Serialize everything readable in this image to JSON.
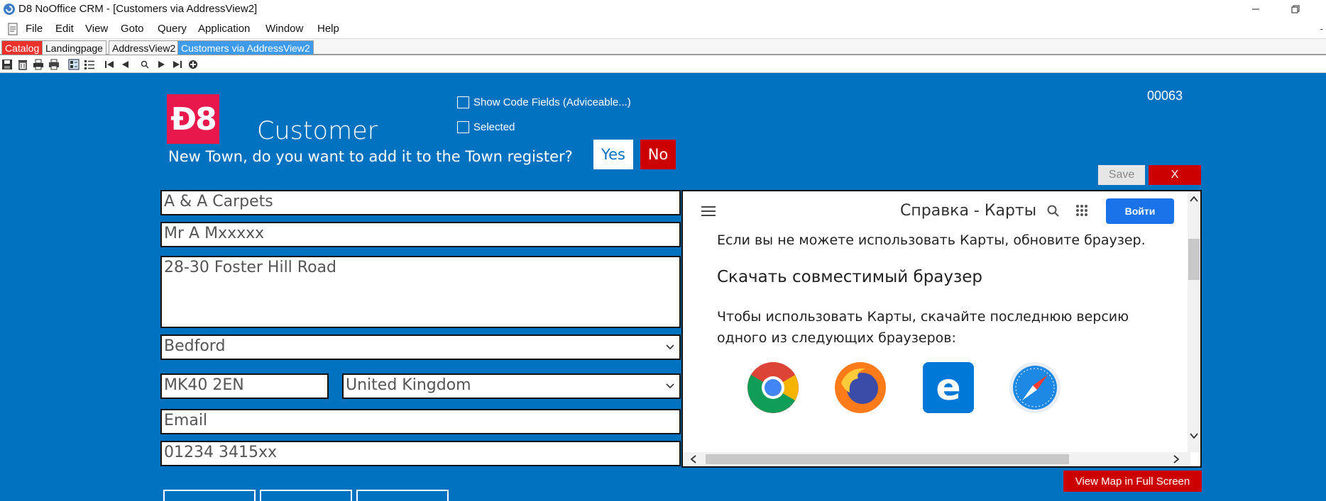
{
  "window": {
    "title": "D8 NoOffice CRM - [Customers via AddressView2]"
  },
  "menu": {
    "items": [
      "File",
      "Edit",
      "View",
      "Goto",
      "Query",
      "Application",
      "Window",
      "Help"
    ],
    "mini": "-"
  },
  "tabs": [
    {
      "label": "Catalog",
      "style": "catalog"
    },
    {
      "label": "Landingpage",
      "style": "plain"
    },
    {
      "label": "AddressView2",
      "style": "plain"
    },
    {
      "label": "Customers via AddressView2",
      "style": "active"
    }
  ],
  "toolbar": {
    "icons": [
      "save-icon",
      "delete-icon",
      "print-preview-icon",
      "print-icon",
      "form-view-icon",
      "list-view-icon",
      "first-record-icon",
      "previous-record-icon",
      "search-icon",
      "next-record-icon",
      "last-record-icon",
      "new-record-icon"
    ]
  },
  "form": {
    "logo_text": "Ð8",
    "heading": "Customer",
    "prompt": "New Town, do you want to add it to the Town register?",
    "yes_label": "Yes",
    "no_label": "No",
    "show_code_fields_label": "Show Code Fields (Adviceable...)",
    "selected_label": "Selected",
    "record_number": "00063",
    "save_label": "Save",
    "close_label": "X",
    "company": "A & A Carpets",
    "contact": "Mr A Mxxxxx",
    "address": "28-30 Foster Hill Road",
    "town": "Bedford",
    "postcode": "MK40 2EN",
    "country": "United Kingdom",
    "email": "Email",
    "phone": "01234 3415xx",
    "full_map_label": "View Map in Full Screen"
  },
  "map": {
    "title": "Справка - Карты",
    "signin_label": "Войти",
    "note": "Если вы не можете использовать Карты, обновите браузер.",
    "heading": "Скачать совместимый браузер",
    "paragraph": "Чтобы использовать Карты, скачайте последнюю версию одного из следующих браузеров:",
    "browsers": [
      "chrome-icon",
      "firefox-icon",
      "edge-icon",
      "safari-icon"
    ]
  },
  "colors": {
    "main_blue": "#0072c0",
    "brand_pink": "#e8184c",
    "danger_red": "#cc0000",
    "tab_active": "#3d9be9",
    "tab_catalog": "#e8322b",
    "google_blue": "#1a73e8"
  }
}
